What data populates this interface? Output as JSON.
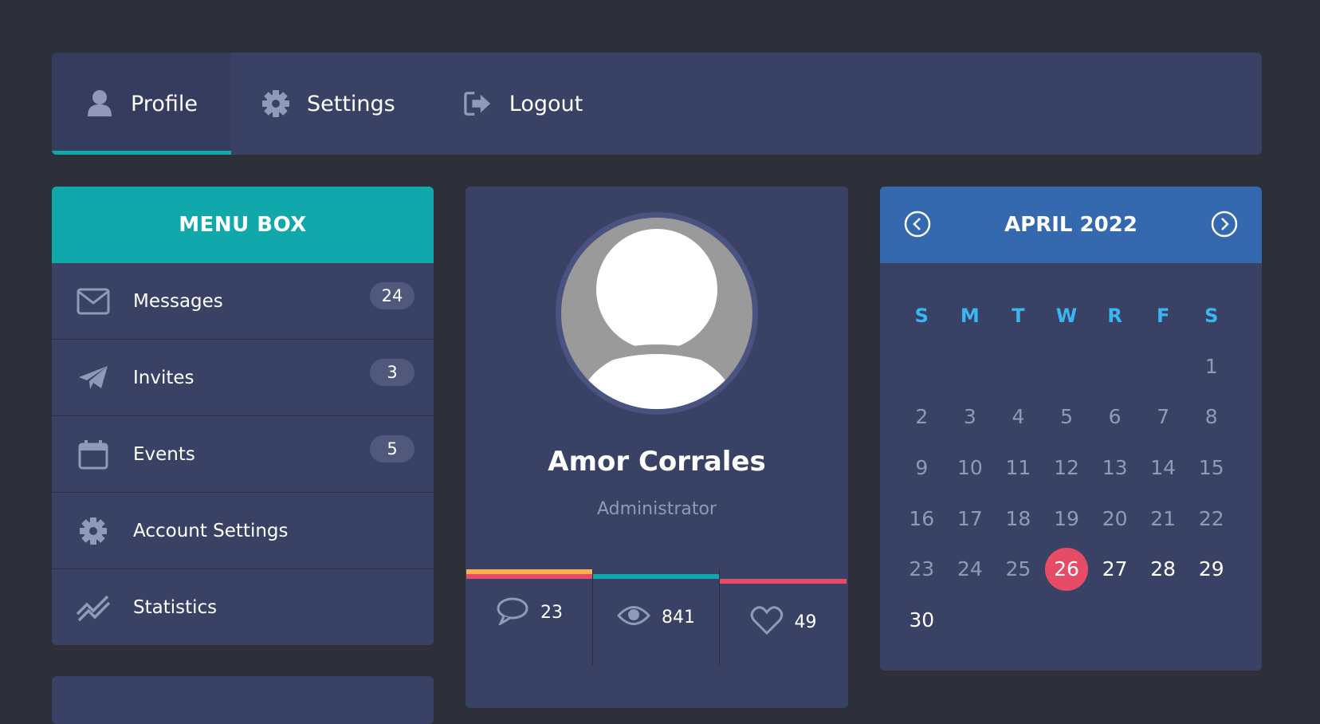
{
  "nav": {
    "items": [
      {
        "label": "Profile",
        "icon": "user-icon",
        "active": true
      },
      {
        "label": "Settings",
        "icon": "gear-icon",
        "active": false
      },
      {
        "label": "Logout",
        "icon": "logout-icon",
        "active": false
      }
    ]
  },
  "menu_box": {
    "title": "MENU BOX",
    "items": [
      {
        "label": "Messages",
        "icon": "envelope-icon",
        "badge": "24"
      },
      {
        "label": "Invites",
        "icon": "paper-plane-icon",
        "badge": "3"
      },
      {
        "label": "Events",
        "icon": "calendar-icon",
        "badge": "5"
      },
      {
        "label": "Account Settings",
        "icon": "gear-icon",
        "badge": null
      },
      {
        "label": "Statistics",
        "icon": "stats-line-icon",
        "badge": null
      }
    ]
  },
  "profile": {
    "name": "Amor Corrales",
    "role": "Administrator",
    "stats": {
      "comments": "23",
      "views": "841",
      "likes": "49"
    }
  },
  "calendar": {
    "title": "APRIL 2022",
    "days_of_week": [
      "S",
      "M",
      "T",
      "W",
      "R",
      "F",
      "S"
    ],
    "weeks": [
      [
        "",
        "",
        "",
        "",
        "",
        "",
        "1"
      ],
      [
        "2",
        "3",
        "4",
        "5",
        "6",
        "7",
        "8"
      ],
      [
        "9",
        "10",
        "11",
        "12",
        "13",
        "14",
        "15"
      ],
      [
        "16",
        "17",
        "18",
        "19",
        "20",
        "21",
        "22"
      ],
      [
        "23",
        "24",
        "25",
        "26",
        "27",
        "28",
        "29"
      ],
      [
        "30",
        "",
        "",
        "",
        "",
        "",
        ""
      ]
    ],
    "today": "26"
  },
  "colors": {
    "background": "#2d3039",
    "panel": "#394264",
    "teal": "#11a8ab",
    "blue": "#3468af",
    "red": "#e64c65",
    "yellow": "#fcb150",
    "weekday_blue": "#3bb6f0",
    "muted_text": "#9099b7"
  }
}
